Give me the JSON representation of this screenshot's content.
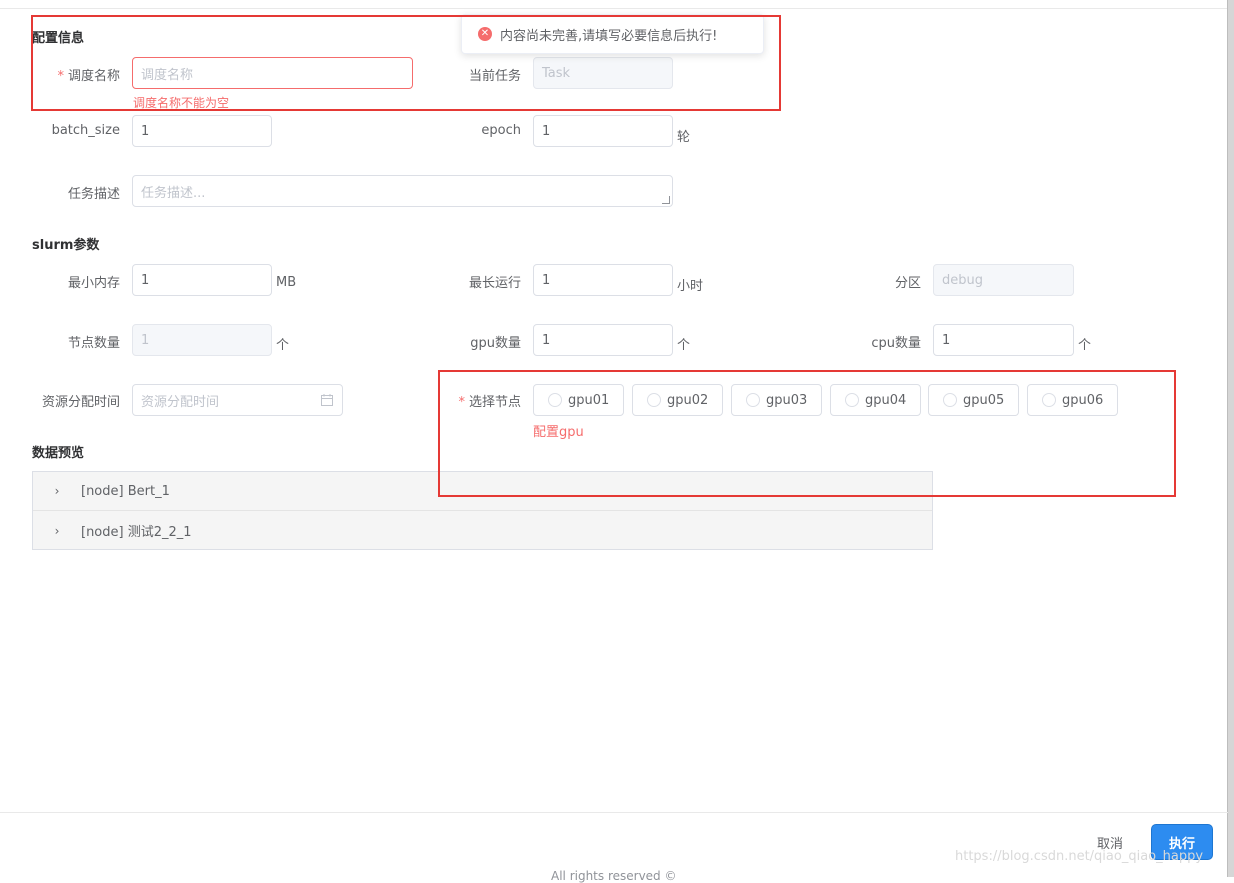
{
  "toast": {
    "message": "内容尚未完善,请填写必要信息后执行!"
  },
  "sections": {
    "config": "配置信息",
    "slurm": "slurm参数",
    "preview": "数据预览"
  },
  "config": {
    "schedule_name": {
      "label": "调度名称",
      "placeholder": "调度名称",
      "value": "",
      "error": "调度名称不能为空"
    },
    "current_task": {
      "label": "当前任务",
      "placeholder": "Task"
    },
    "batch_size": {
      "label": "batch_size",
      "value": "1"
    },
    "epoch": {
      "label": "epoch",
      "value": "1",
      "unit": "轮"
    },
    "description": {
      "label": "任务描述",
      "placeholder": "任务描述..."
    }
  },
  "slurm": {
    "min_memory": {
      "label": "最小内存",
      "value": "1",
      "unit": "MB"
    },
    "max_runtime": {
      "label": "最长运行",
      "value": "1",
      "unit": "小时"
    },
    "partition": {
      "label": "分区",
      "placeholder": "debug"
    },
    "node_count": {
      "label": "节点数量",
      "value": "1",
      "unit": "个"
    },
    "gpu_count": {
      "label": "gpu数量",
      "value": "1",
      "unit": "个"
    },
    "cpu_count": {
      "label": "cpu数量",
      "value": "1",
      "unit": "个"
    },
    "alloc_time": {
      "label": "资源分配时间",
      "placeholder": "资源分配时间"
    },
    "select_node": {
      "label": "选择节点",
      "options": [
        "gpu01",
        "gpu02",
        "gpu03",
        "gpu04",
        "gpu05",
        "gpu06"
      ],
      "error": "配置gpu"
    }
  },
  "preview": {
    "items": [
      "[node] Bert_1",
      "[node] 测试2_2_1"
    ]
  },
  "footer": {
    "cancel": "取消",
    "execute": "执行",
    "bottom_text": "All rights reserved ©"
  },
  "watermark": "https://blog.csdn.net/qiao_qiao_happy",
  "colors": {
    "error": "#f56c6c",
    "primary": "#2d8cf0",
    "highlight_box": "#e53935"
  },
  "icons": {
    "toast": "error-circle-icon",
    "date": "calendar-icon",
    "expand": "chevron-right-icon"
  }
}
